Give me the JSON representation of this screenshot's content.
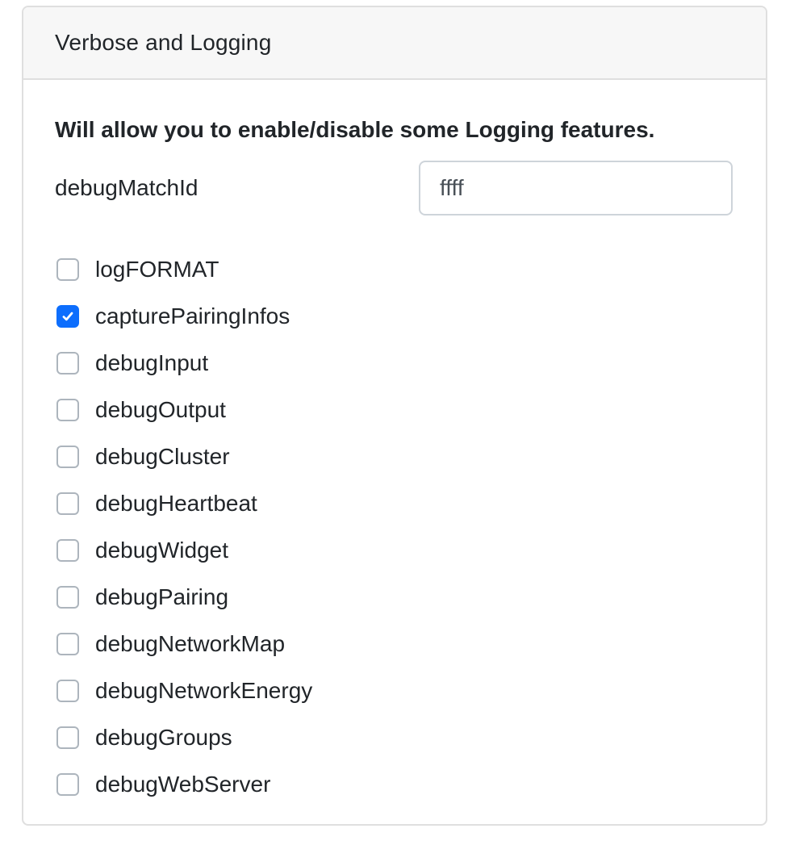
{
  "panel": {
    "title": "Verbose and Logging",
    "description": "Will allow you to enable/disable some Logging features."
  },
  "debug_match_id": {
    "label": "debugMatchId",
    "value": "ffff"
  },
  "options": [
    {
      "label": "logFORMAT",
      "checked": false
    },
    {
      "label": "capturePairingInfos",
      "checked": true
    },
    {
      "label": "debugInput",
      "checked": false
    },
    {
      "label": "debugOutput",
      "checked": false
    },
    {
      "label": "debugCluster",
      "checked": false
    },
    {
      "label": "debugHeartbeat",
      "checked": false
    },
    {
      "label": "debugWidget",
      "checked": false
    },
    {
      "label": "debugPairing",
      "checked": false
    },
    {
      "label": "debugNetworkMap",
      "checked": false
    },
    {
      "label": "debugNetworkEnergy",
      "checked": false
    },
    {
      "label": "debugGroups",
      "checked": false
    },
    {
      "label": "debugWebServer",
      "checked": false
    }
  ],
  "colors": {
    "accent": "#0d6efd",
    "header_bg": "#f7f7f7",
    "border": "#dfdfdf",
    "text": "#212529"
  },
  "icons": {
    "checkbox_checked": "checkmark-icon"
  }
}
